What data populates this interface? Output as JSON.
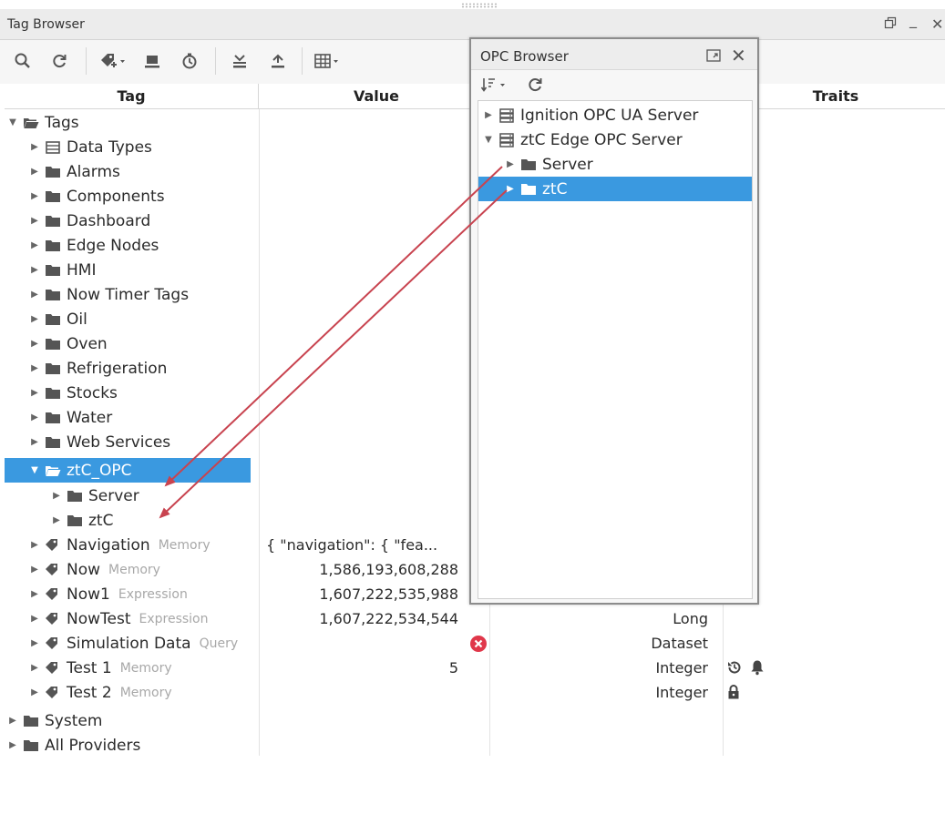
{
  "window": {
    "title": "Tag Browser"
  },
  "toolbar": {
    "icons": [
      "search-icon",
      "refresh-icon",
      "add-tag-icon",
      "import-icon",
      "history-icon",
      "collapse-icon",
      "export-icon",
      "table-view-icon"
    ]
  },
  "columns": {
    "tag": "Tag",
    "value": "Value",
    "traits": "Traits"
  },
  "tree": {
    "root": "Tags",
    "folders": [
      "Data Types",
      "Alarms",
      "Components",
      "Dashboard",
      "Edge Nodes",
      "HMI",
      "Now Timer Tags",
      "Oil",
      "Oven",
      "Refrigeration",
      "Stocks",
      "Water",
      "Web Services"
    ],
    "selected": "ztC_OPC",
    "children": [
      "Server",
      "ztC"
    ],
    "tags": [
      {
        "name": "Navigation",
        "kind": "Memory",
        "value": "{   \"navigation\": {     \"fea...",
        "datatype": ""
      },
      {
        "name": "Now",
        "kind": "Memory",
        "value": "1,586,193,608,288",
        "datatype": ""
      },
      {
        "name": "Now1",
        "kind": "Expression",
        "value": "1,607,222,535,988",
        "datatype": ""
      },
      {
        "name": "NowTest",
        "kind": "Expression",
        "value": "1,607,222,534,544",
        "datatype": "Long"
      },
      {
        "name": "Simulation Data",
        "kind": "Query",
        "value": "",
        "datatype": "Dataset"
      },
      {
        "name": "Test 1",
        "kind": "Memory",
        "value": "5",
        "datatype": "Integer"
      },
      {
        "name": "Test 2",
        "kind": "Memory",
        "value": "",
        "datatype": "Integer"
      }
    ],
    "bottom": [
      "System",
      "All Providers"
    ]
  },
  "opc": {
    "title": "OPC Browser",
    "nodes": [
      "Ignition OPC UA Server",
      "ztC Edge OPC Server",
      "Server",
      "ztC"
    ]
  },
  "colors": {
    "selection": "#3a99e0",
    "arrow": "#c8434f",
    "error": "#e0374a"
  }
}
